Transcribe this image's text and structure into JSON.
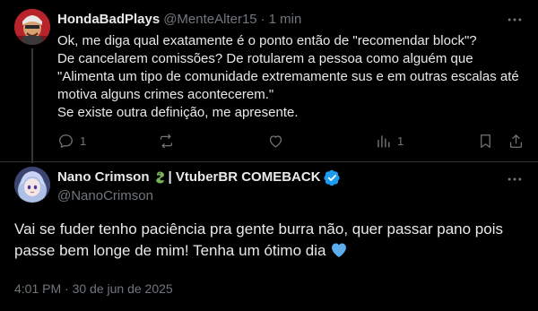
{
  "reply": {
    "display_name": "HondaBadPlays",
    "handle": "@MenteAlter15",
    "separator": "·",
    "time": "1 min",
    "avatar_icon": "avatar-icon",
    "text_lines": [
      "Ok, me diga qual exatamente é o ponto então de \"recomendar block\"?",
      "De cancelarem comissões? De rotularem a pessoa como alguém que",
      "\"Alimenta um tipo de comunidade extremamente sus e em outras escalas até",
      "motiva alguns crimes acontecerem.\"",
      "Se existe outra definição, me apresente."
    ],
    "actions": {
      "reply_count": "1",
      "repost_count": "",
      "like_count": "",
      "views_count": "1"
    }
  },
  "main": {
    "display_name": "Nano Crimson",
    "display_name_suffix": "| VtuberBR COMEBACK",
    "handle": "@NanoCrimson",
    "text_lines": [
      "Vai se fuder tenho paciência pra gente burra não, quer passar pano pois",
      "passe bem longe de mim! Tenha um ótimo dia"
    ],
    "timestamp": "4:01 PM · 30 de jun de 2025"
  },
  "colors": {
    "background": "#000000",
    "text": "#e7e9ea",
    "muted": "#71767b",
    "divider": "#2f3336",
    "verified": "#1d9bf0",
    "heart_emoji": "#5dadec",
    "snake_emoji": "#78b159"
  }
}
